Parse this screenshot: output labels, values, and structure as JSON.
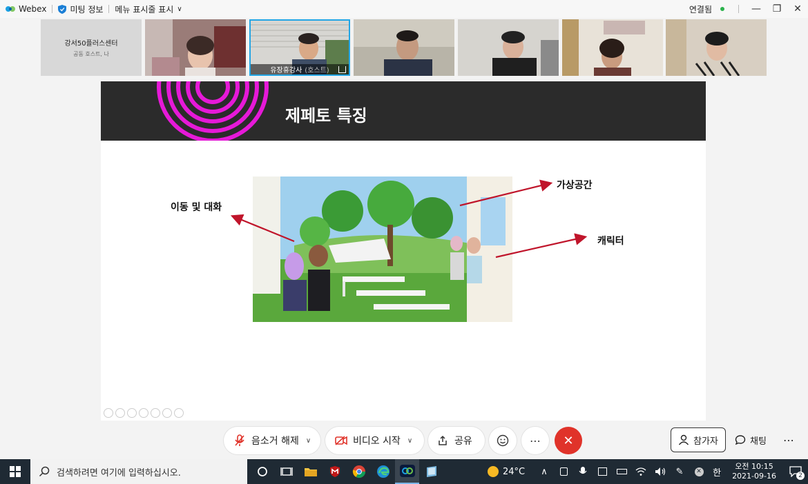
{
  "titlebar": {
    "app_name": "Webex",
    "meeting_info": "미팅 정보",
    "menu_toggle": "메뉴 표시줄 표시",
    "status": "연결됨"
  },
  "filmstrip": {
    "tiles": [
      {
        "name": "강서50플러스센터",
        "sub": "공동 호스트, 나"
      },
      {
        "name": ""
      },
      {
        "name": "유장휴강사",
        "role": "(호스트)"
      },
      {
        "name": ""
      },
      {
        "name": ""
      },
      {
        "name": ""
      },
      {
        "name": ""
      }
    ]
  },
  "slide": {
    "title": "제페토 특징",
    "labels": {
      "movement": "이동 및 대화",
      "virtual_space": "가상공간",
      "character": "캐릭터"
    }
  },
  "controls": {
    "unmute": "음소거 해제",
    "start_video": "비디오 시작",
    "share": "공유",
    "participants": "참가자",
    "chat": "채팅"
  },
  "taskbar": {
    "search_placeholder": "검색하려면 여기에 입력하십시오.",
    "weather": "24°C",
    "ime": "한",
    "time": "오전 10:15",
    "date": "2021-09-16",
    "notifications": "2"
  },
  "colors": {
    "accent_blue": "#22a6e6",
    "end_red": "#e0332a",
    "slide_header": "#2b2b2b",
    "magenta": "#e619d8",
    "arrow_red": "#c0152b"
  }
}
